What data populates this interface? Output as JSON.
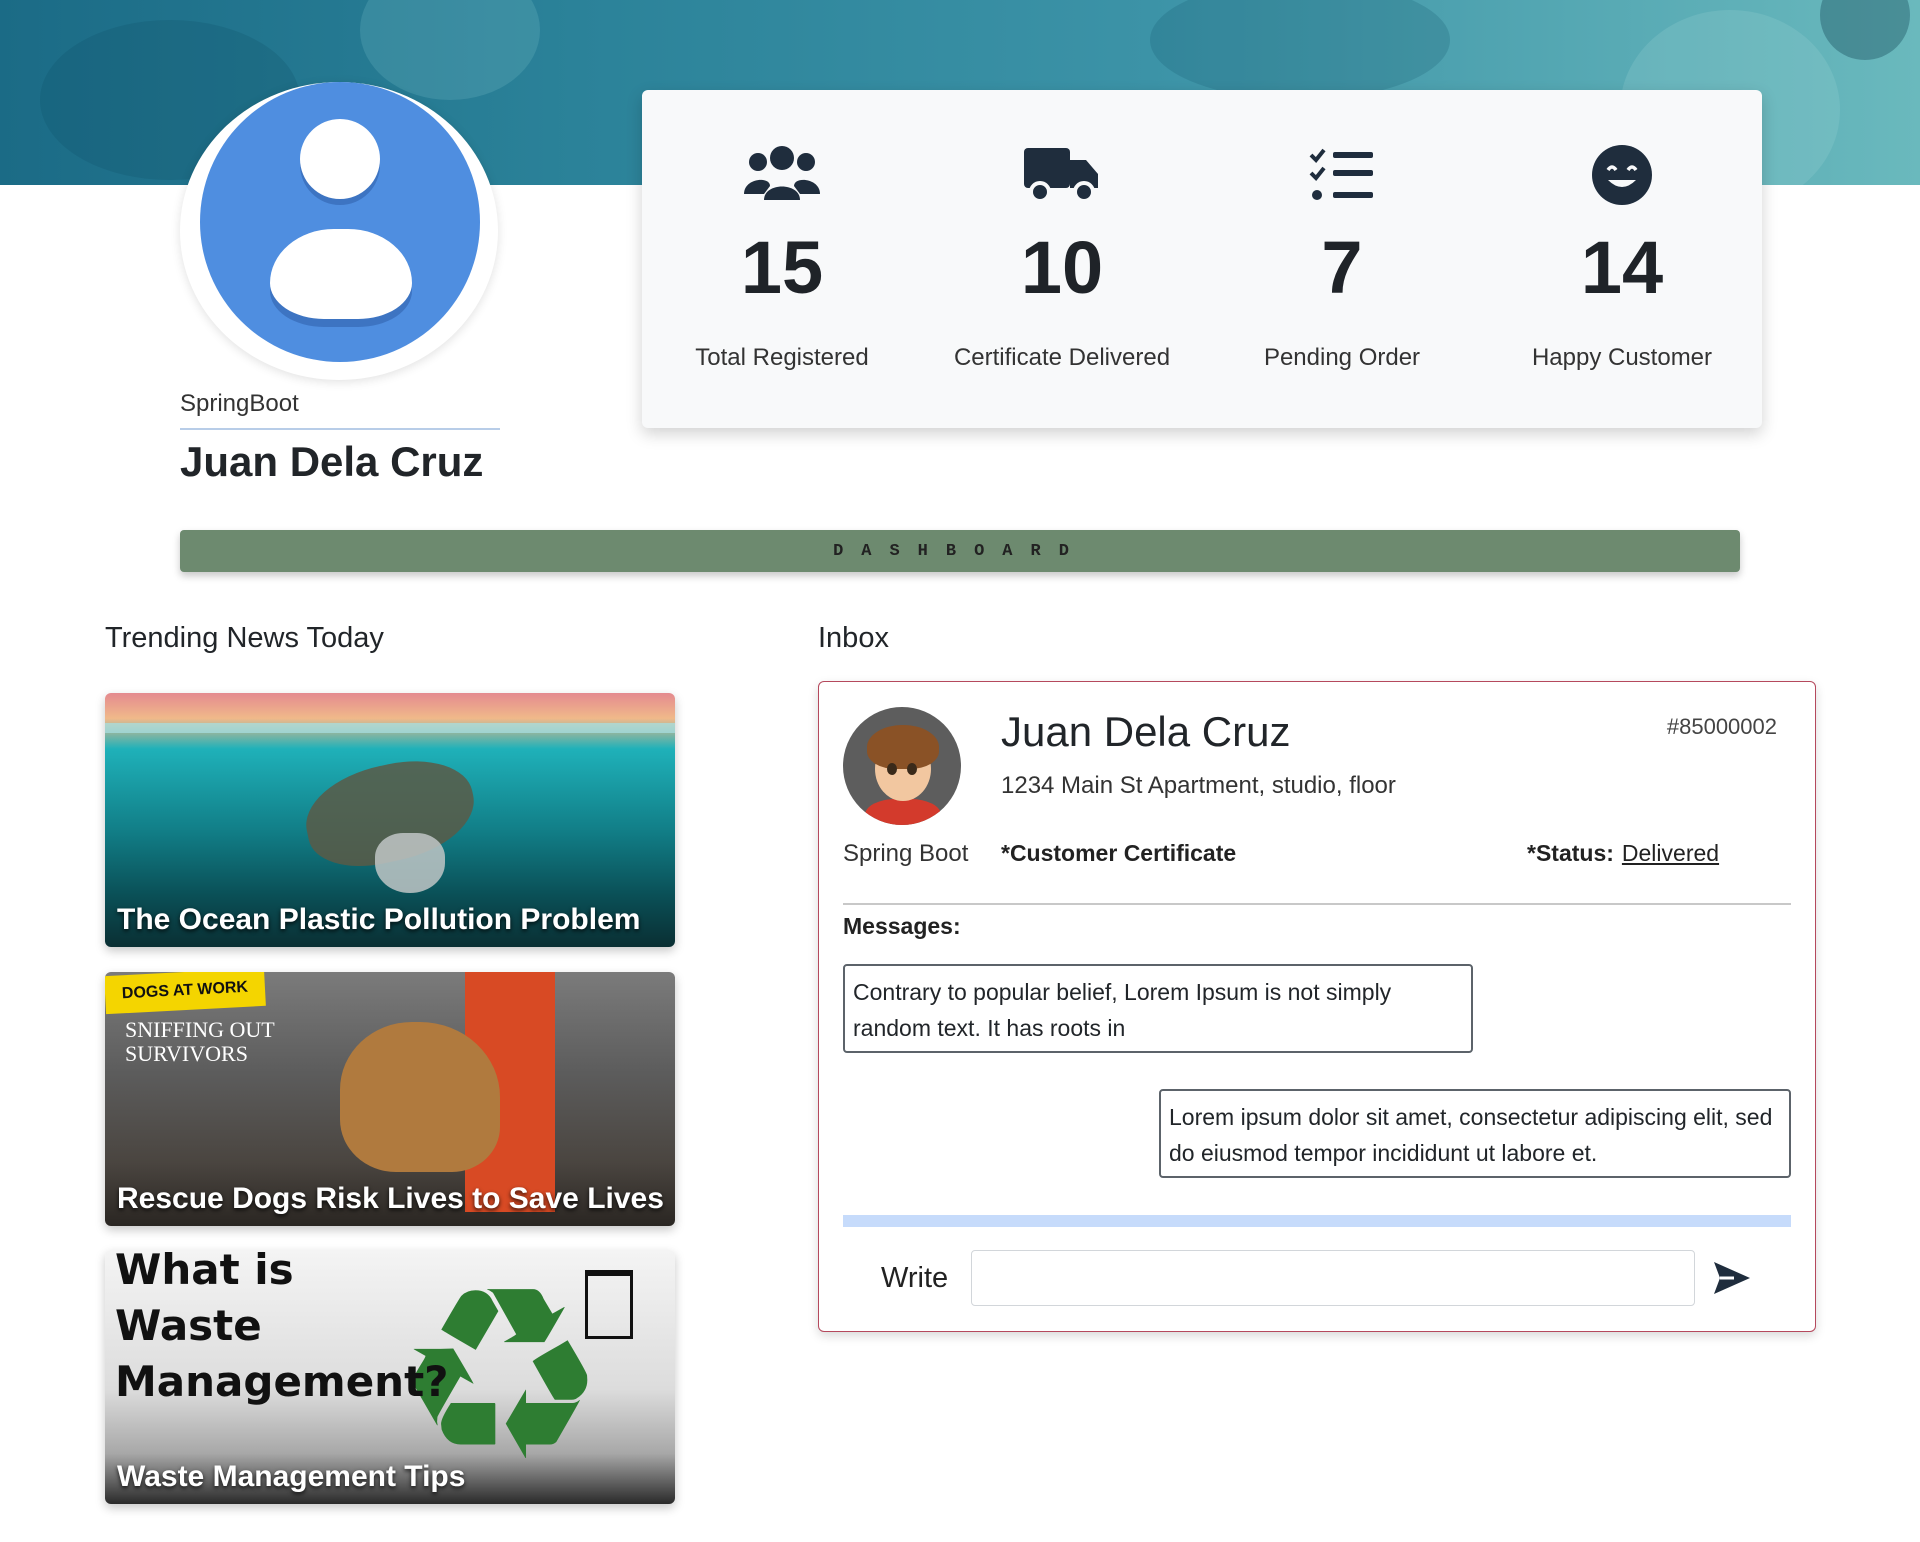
{
  "profile": {
    "brand": "SpringBoot",
    "name": "Juan Dela Cruz"
  },
  "stats": [
    {
      "icon": "users-icon",
      "value": "15",
      "label": "Total Registered"
    },
    {
      "icon": "truck-icon",
      "value": "10",
      "label": "Certificate Delivered"
    },
    {
      "icon": "checklist-icon",
      "value": "7",
      "label": "Pending Order"
    },
    {
      "icon": "smile-icon",
      "value": "14",
      "label": "Happy Customer"
    }
  ],
  "dashboard": {
    "label": "DASHBOARD"
  },
  "news": {
    "title": "Trending News Today",
    "items": [
      {
        "caption": "The Ocean Plastic Pollution Problem"
      },
      {
        "caption": "Rescue Dogs Risk Lives to Save Lives",
        "overlay_tag": "DOGS AT WORK",
        "overlay_text": "SNIFFING OUT SURVIVORS"
      },
      {
        "caption": "Waste Management Tips",
        "overlay_text": "What is Waste Management?"
      }
    ]
  },
  "inbox": {
    "title": "Inbox",
    "user_label": "Spring Boot",
    "name": "Juan Dela Cruz",
    "address": "1234 Main St Apartment, studio, floor",
    "id": "#85000002",
    "certificate": "*Customer Certificate",
    "status_label": "*Status:",
    "status_value": "Delivered",
    "messages_label": "Messages:",
    "messages": [
      {
        "direction": "in",
        "text": "Contrary to popular belief, Lorem Ipsum is not simply random text. It has roots in"
      },
      {
        "direction": "out",
        "text": "Lorem ipsum dolor sit amet, consectetur adipiscing elit, sed do eiusmod tempor incididunt ut labore et."
      }
    ],
    "write_label": "Write",
    "write_value": "",
    "send_icon": "send-icon"
  },
  "colors": {
    "avatar_blue": "#4f8ee0",
    "dashboard_bar": "#6d8a6f",
    "inbox_border": "#b5495d",
    "icon_dark": "#1f2d3d"
  }
}
